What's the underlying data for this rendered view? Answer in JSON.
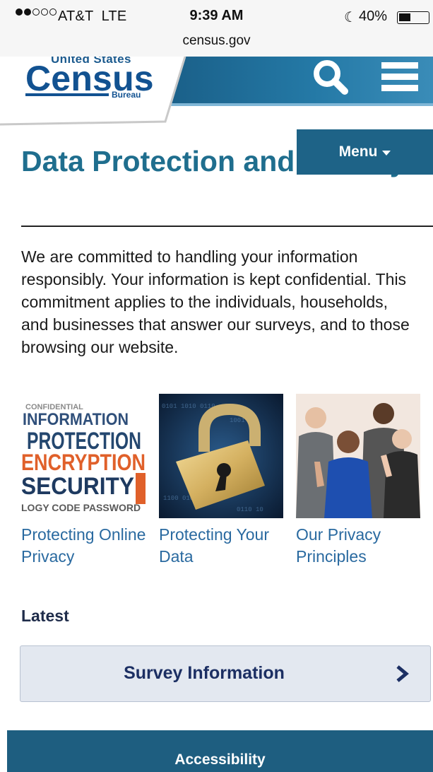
{
  "status_bar": {
    "signal_bars_filled": 2,
    "signal_bars_total": 5,
    "carrier": "AT&T  LTE",
    "time": "9:39 AM",
    "moon_icon": "moon-icon",
    "battery_percent": "40%",
    "battery_level": 0.4
  },
  "browser": {
    "url": "census.gov"
  },
  "header": {
    "logo_top": "United States",
    "logo_main": "Census",
    "logo_sub": "Bureau",
    "band_color": "#1d6b95",
    "search_icon": "search-icon",
    "menu_icon": "hamburger-menu-icon"
  },
  "page": {
    "title": "Data Protection and Privacy",
    "menu_label": "Menu",
    "intro": "We are committed to handling your information responsibly. Your information is kept confidential. This commitment applies to the individuals, households, and businesses that answer our surveys, and to those browsing our website.",
    "cards": [
      {
        "label": "Protecting Online Privacy",
        "image": "word-cloud-image",
        "words": [
          "INFORMATION",
          "PROTECTION",
          "ENCRYPTION",
          "SECURITY"
        ]
      },
      {
        "label": "Protecting Your Data",
        "image": "padlock-image"
      },
      {
        "label": "Our Privacy Principles",
        "image": "people-raising-hands-image"
      }
    ],
    "latest_heading": "Latest",
    "survey_button": "Survey Information",
    "footer_label": "Accessibility"
  },
  "colors": {
    "title": "#1f6e8e",
    "link": "#2a6aa0",
    "menu_button": "#1e6387",
    "footer": "#1e5e80"
  }
}
